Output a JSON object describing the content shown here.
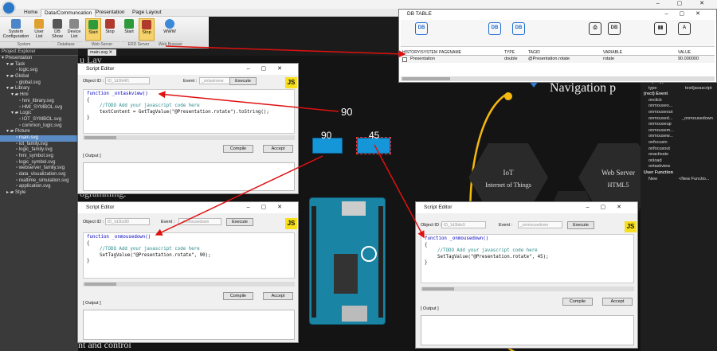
{
  "ribbon": {
    "tabs": [
      "Home",
      "Data/Communcation",
      "Presentation",
      "Page Layout"
    ],
    "buttons": [
      "System Configuration",
      "User List",
      "DB Show",
      "Device List",
      "Start",
      "Stop",
      "Start",
      "Stop",
      "WWW"
    ],
    "groups": [
      "System",
      "Database",
      "Web Server",
      "ERD Server",
      "Web Browser"
    ]
  },
  "project": {
    "title": "Project Explorer",
    "tree": [
      "Presentation",
      "Task",
      "logic.svg",
      "Global",
      "global.svg",
      "Library",
      "Hmi",
      "hmi_library.svg",
      "HMI_SYMBOL.svg",
      "Logic",
      "IOT_SYMBOL.svg",
      "common_logic.svg",
      "Picture",
      "main.svg",
      "iot_family.svg",
      "logic_family.svg",
      "hmi_symbol.svg",
      "logic_symbol.svg",
      "webserver_family.svg",
      "data_visualization.svg",
      "realtime_simulation.svg",
      "application.svg",
      "Style"
    ]
  },
  "doc_tab": "main.svg",
  "db_table": {
    "title": "DB TABLE",
    "headers": [
      "HISTORY/SYSTEM",
      "PAGENAME",
      "TYPE",
      "TAGID",
      "VARIABLE",
      "VALUE"
    ],
    "row": [
      "Presentation",
      "",
      "double",
      "@Presentation.rotate",
      "rotate",
      "90.000000"
    ]
  },
  "editor1": {
    "title": "Script Editor",
    "objid_label": "Object ID :",
    "objid": "ID_1d3fd4f1",
    "event_label": "Event :",
    "event": "_ontaskview",
    "execute": "Execute",
    "js": "JS",
    "code": [
      "function _ontaskview()",
      "{",
      "//TODO Add your javascript code here",
      "textContent = GetTagValue(\"@Presentation.rotate\").toString();",
      "}"
    ],
    "compile": "Compile",
    "accept": "Accept",
    "output": "[ Output ]"
  },
  "editor2": {
    "title": "Script Editor",
    "objid_label": "Object ID :",
    "objid": "ID_1d3bc80",
    "event_label": "Event :",
    "event": "_onmousedown",
    "execute": "Execute",
    "js": "JS",
    "code": [
      "function _onmousedown()",
      "{",
      "//TODO Add your javascript code here",
      "SetTagValue(\"@Presentation.rotate\", 90);",
      "}"
    ],
    "compile": "Compile",
    "accept": "Accept",
    "output": "[ Output ]"
  },
  "editor3": {
    "title": "Script Editor",
    "objid_label": "Object ID :",
    "objid": "ID_1d3bbc5",
    "event_label": "Event :",
    "event": "_onmousedown",
    "execute": "Execute",
    "js": "JS",
    "code": [
      "function _onmousedown()",
      "{",
      "//TODO Add your javascript code here",
      "SetTagValue(\"@Presentation.rotate\", 45);",
      "}"
    ],
    "compile": "Compile",
    "accept": "Accept",
    "output": "[ Output ]"
  },
  "canvas": {
    "readout": "90",
    "btn90": "90",
    "btn45": "45",
    "heading": "Navigation p",
    "iot_title": "IoT",
    "iot_sub": "Internet of Things",
    "web_title": "Web Server",
    "web_sub": "HTML5",
    "bottom_text": "nt and control",
    "left_text": "ogramming.",
    "top_text": "u Lay"
  },
  "props": {
    "items": [
      "Script Type",
      "type",
      "(rect) Event",
      "onclick",
      "onmouseo...",
      "onmouseout",
      "onmoused...",
      "onmouseup",
      "onmousem...",
      "onmousew...",
      "onfocusin",
      "onfocusout",
      "onactivate",
      "onload",
      "ontaskview",
      "User Function",
      "New"
    ],
    "type_value": "text/javascript",
    "mousedown_value": "_onmousedown",
    "new_value": "<New Functio..."
  }
}
